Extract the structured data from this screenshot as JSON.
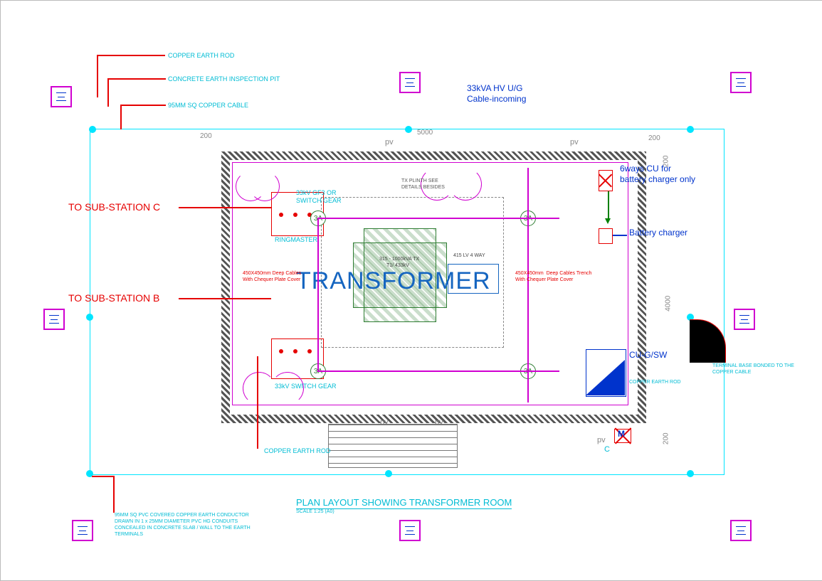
{
  "title": "PLAN LAYOUT SHOWING TRANSFORMER ROOM",
  "scale": "SCALE 1:25 (A0)",
  "transformer_label": "TRANSFORMER",
  "callouts": {
    "to_sub_c": "TO SUB-STATION C",
    "to_sub_b": "TO SUB-STATION B",
    "hv_cable_1": "33kVA HV U/G",
    "hv_cable_2": "Cable-incoming",
    "cu6_1": "6ways CU for",
    "cu6_2": "battery charger only",
    "batt_charger": "Battery charger",
    "cu_gsw": "CU-G/SW",
    "terminal_bond_1": "TERMINAL BASE BONDED TO THE",
    "terminal_bond_2": "COPPER CABLE"
  },
  "legend": {
    "copper_rod": "COPPER EARTH ROD",
    "inspection_pit": "CONCRETE EARTH INSPECTION PIT",
    "cu_cable": "95MM SQ COPPER CABLE",
    "copper_rod2": "COPPER EARTH ROD",
    "copper_rod3": "COPPER EARTH ROD"
  },
  "notes": {
    "trench1_a": "450X450mm Deep Cables",
    "trench1_b": "With Chequer Plate Cover",
    "trench2_a": "450X450mm  Deep Cables Trench",
    "trench2_b": "With Chequer Plate Cover",
    "tx_spec_a": "315 - 1000kVA TX",
    "tx_spec_b": "T1/ 433kV",
    "plinth_a": "TX PLINTH SEE",
    "plinth_b": "DETAILS BESIDES",
    "sg_upper_a": "33kV GF3 OR",
    "sg_upper_b": "SWITCH GEAR",
    "ringmaster": "RINGMASTER",
    "sg_lower": "33kV SWITCH GEAR",
    "lv4way": "415 LV 4 WAY",
    "conductor_1": "95MM SQ PVC COVERED COPPER EARTH CONDUCTOR",
    "conductor_2": "DRAWN IN 1 x 25MM DIAMETER PVC HG CONDUITS",
    "conductor_3": "CONCEALED IN CONCRETE SLAB / WALL TO THE EARTH",
    "conductor_4": "TERMINALS"
  },
  "dims": {
    "d200": "200",
    "d5000": "5000",
    "d4000": "4000",
    "pv": "pv",
    "c": "C",
    "m": "M"
  },
  "badge": "3A"
}
